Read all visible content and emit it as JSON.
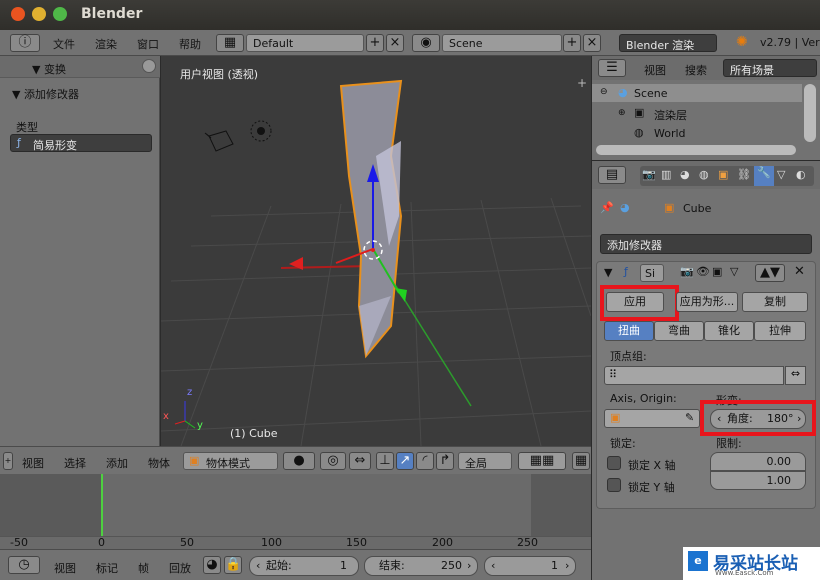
{
  "window": {
    "title": "Blender"
  },
  "menubar": {
    "file": "文件",
    "render": "渲染",
    "window": "窗口",
    "help": "帮助",
    "layout": "Default",
    "scene": "Scene",
    "engine": "Blender 渲染",
    "version": "v2.79 | Ver"
  },
  "left_panel": {
    "transform_title": "▼ 变换",
    "add_modifier_title": "▼ 添加修改器",
    "type_label": "类型",
    "type_value": "简易形变"
  },
  "viewport": {
    "view_label": "用户视图 (透视)",
    "object_label": "(1) Cube",
    "axis_x": "x",
    "axis_y": "y",
    "axis_z": "z"
  },
  "outliner": {
    "view": "视图",
    "search": "搜索",
    "filter": "所有场景",
    "items": [
      "Scene",
      "渲染层",
      "World"
    ]
  },
  "properties": {
    "breadcrumb_object": "Cube",
    "add_modifier": "添加修改器",
    "modifier_name": "Si",
    "apply": "应用",
    "apply_as_shape": "应用为形...",
    "copy": "复制",
    "tabs": [
      "扭曲",
      "弯曲",
      "锥化",
      "拉伸"
    ],
    "vertex_group_label": "顶点组:",
    "axis_origin_label": "Axis, Origin:",
    "deform_label": "形变:",
    "angle_label": "角度:",
    "angle_value": "180°",
    "lock_label": "锁定:",
    "limit_label": "限制:",
    "lock_x": "锁定 X 轴",
    "lock_y": "锁定 Y 轴",
    "limit_min": "0.00",
    "limit_max": "1.00"
  },
  "timeline_header": {
    "view": "视图",
    "select": "选择",
    "add": "添加",
    "object": "物体",
    "mode": "物体模式",
    "global": "全局"
  },
  "timeline": {
    "ticks": [
      "-50",
      "0",
      "50",
      "100",
      "150",
      "200",
      "250"
    ]
  },
  "timeline_bottom": {
    "view": "视图",
    "marker": "标记",
    "frame": "帧",
    "playback": "回放",
    "start_label": "起始:",
    "start_value": "1",
    "end_label": "结束:",
    "end_value": "250",
    "current": "1"
  },
  "watermark": {
    "text": "易采站长站",
    "sub": "Www.Easck.Com"
  }
}
